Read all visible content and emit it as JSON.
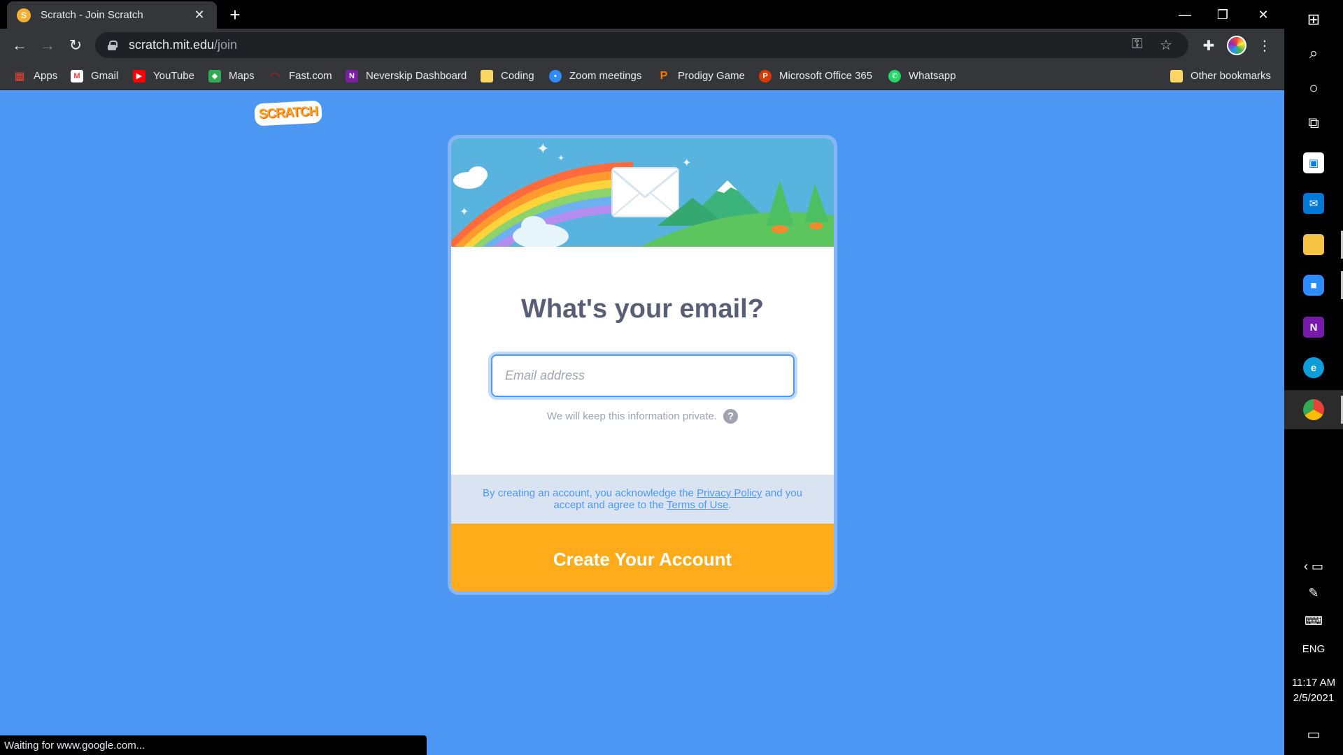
{
  "browser": {
    "tab_title": "Scratch - Join Scratch",
    "tab_close": "✕",
    "new_tab": "+",
    "url_host": "scratch.mit.edu",
    "url_path": "/join",
    "window_controls": {
      "minimize": "—",
      "restore": "❐",
      "close": "✕"
    },
    "bookmarks": [
      {
        "label": "Apps",
        "icon": "apps-grid-icon",
        "color": "#ea4335"
      },
      {
        "label": "Gmail",
        "icon": "gmail-icon",
        "color": "#ea4335"
      },
      {
        "label": "YouTube",
        "icon": "youtube-icon",
        "color": "#ff0000"
      },
      {
        "label": "Maps",
        "icon": "maps-icon",
        "color": "#34a853"
      },
      {
        "label": "Fast.com",
        "icon": "fast-icon",
        "color": "#e50914"
      },
      {
        "label": "Neverskip Dashboard",
        "icon": "neverskip-icon",
        "color": "#7b1fa2"
      },
      {
        "label": "Coding",
        "icon": "folder-icon",
        "color": "#fdd663"
      },
      {
        "label": "Zoom meetings",
        "icon": "zoom-icon",
        "color": "#2d8cff"
      },
      {
        "label": "Prodigy Game",
        "icon": "prodigy-icon",
        "color": "#f57c00"
      },
      {
        "label": "Microsoft Office 365",
        "icon": "office-icon",
        "color": "#d83b01"
      },
      {
        "label": "Whatsapp",
        "icon": "whatsapp-icon",
        "color": "#25d366"
      }
    ],
    "other_bookmarks": "Other bookmarks",
    "status_text": "Waiting for www.google.com..."
  },
  "page": {
    "logo_text": "SCRATCH",
    "heading": "What's your email?",
    "email_placeholder": "Email address",
    "private_note": "We will keep this information private.",
    "help_glyph": "?",
    "legal_prefix": "By creating an account, you acknowledge the ",
    "privacy_link": "Privacy Policy",
    "legal_middle": " and you accept and agree to the ",
    "terms_link": "Terms of Use",
    "legal_suffix": ".",
    "create_button": "Create Your Account",
    "accent_color": "#ffab1a",
    "background_color": "#4d97f4"
  },
  "taskbar": {
    "language": "ENG",
    "time": "11:17 AM",
    "date": "2/5/2021"
  }
}
